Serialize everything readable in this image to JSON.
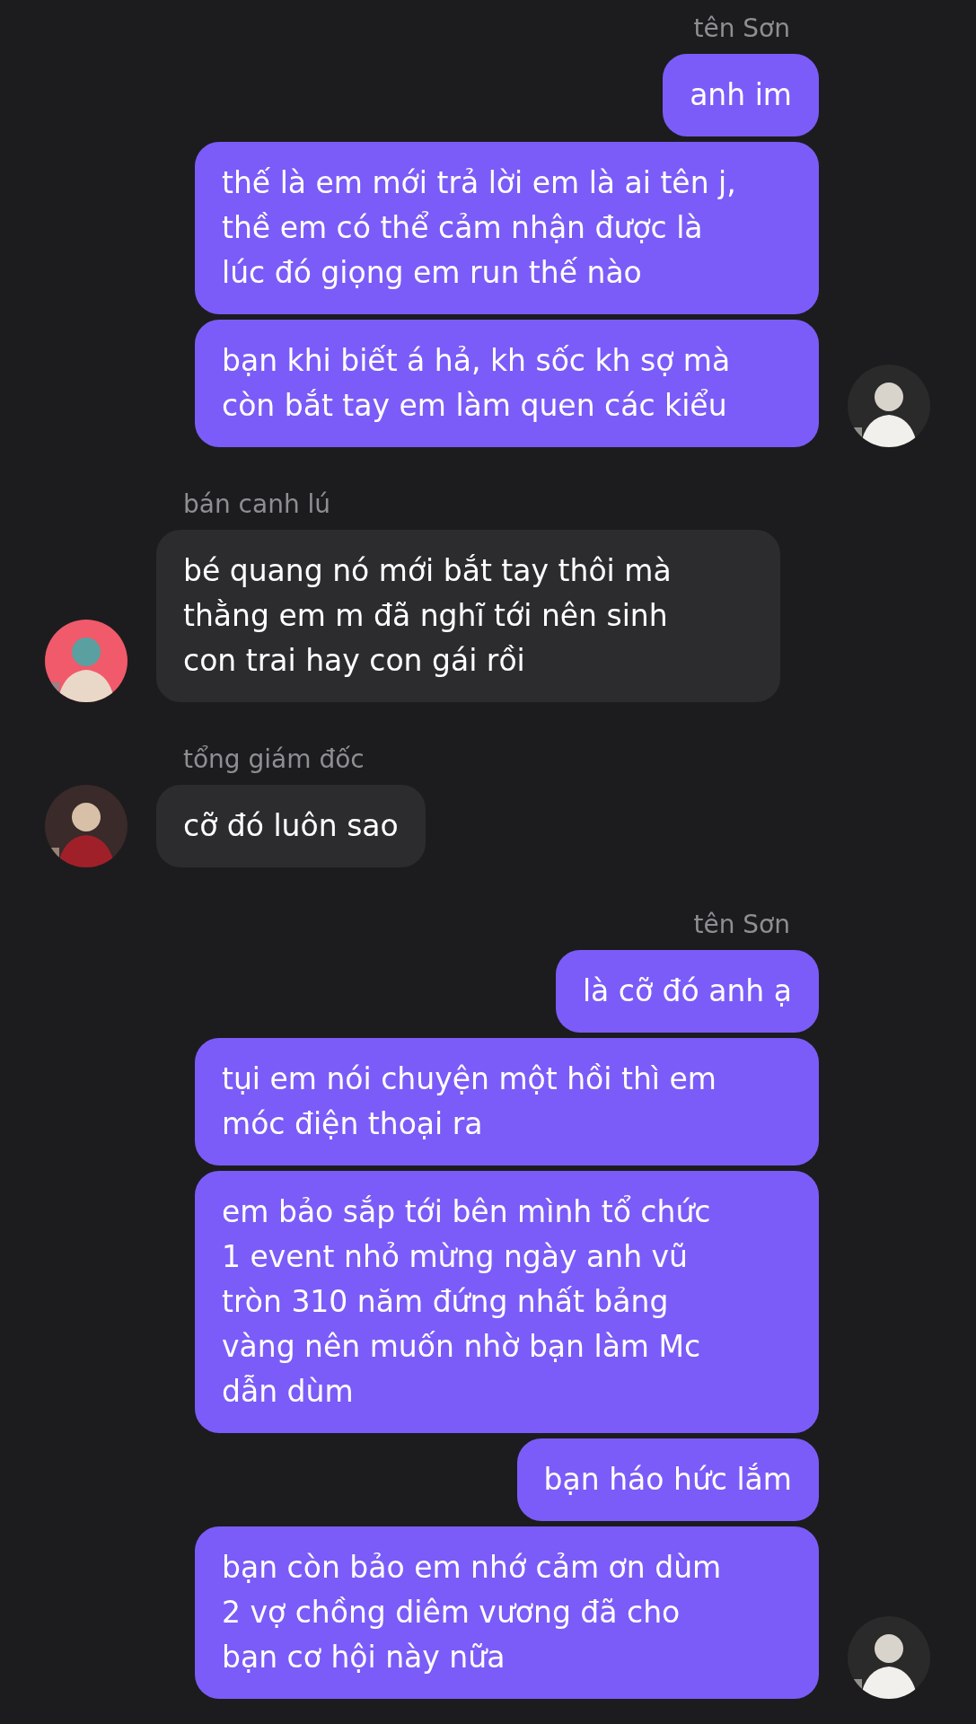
{
  "groups": [
    {
      "kind": "outgoing",
      "sender": "tên Sơn",
      "messages": [
        {
          "lines": [
            "anh im"
          ]
        },
        {
          "lines": [
            "thế là em mới trả lời em là ai tên j,",
            "thề em có thể cảm nhận được là",
            "lúc đó giọng em run thế nào"
          ]
        },
        {
          "lines": [
            "bạn khi biết á hả, kh sốc kh sợ mà",
            "còn bắt tay em làm quen các kiểu"
          ]
        }
      ]
    },
    {
      "kind": "incoming",
      "sender": "bán canh lú",
      "messages": [
        {
          "lines": [
            "bé quang nó mới bắt tay thôi mà",
            "thằng em m đã nghĩ tới nên sinh",
            "con trai hay con gái rồi"
          ]
        }
      ]
    },
    {
      "kind": "incoming",
      "sender": "tổng giám đốc",
      "messages": [
        {
          "lines": [
            "cỡ đó luôn sao"
          ]
        }
      ]
    },
    {
      "kind": "outgoing",
      "sender": "tên Sơn",
      "messages": [
        {
          "lines": [
            "là cỡ đó anh ạ"
          ]
        },
        {
          "lines": [
            "tụi em nói chuyện một hồi thì em",
            "móc điện thoại ra"
          ]
        },
        {
          "lines": [
            "em bảo sắp tới bên mình tổ chức",
            "1 event nhỏ mừng ngày anh vũ",
            "tròn 310 năm đứng nhất bảng",
            "vàng nên muốn nhờ bạn làm Mc",
            "dẫn dùm"
          ]
        },
        {
          "lines": [
            "bạn háo hức lắm"
          ]
        },
        {
          "lines": [
            "bạn còn bảo em nhớ cảm ơn dùm",
            "2 vợ chồng diêm vương đã cho",
            "bạn cơ hội này nữa"
          ]
        }
      ]
    }
  ]
}
